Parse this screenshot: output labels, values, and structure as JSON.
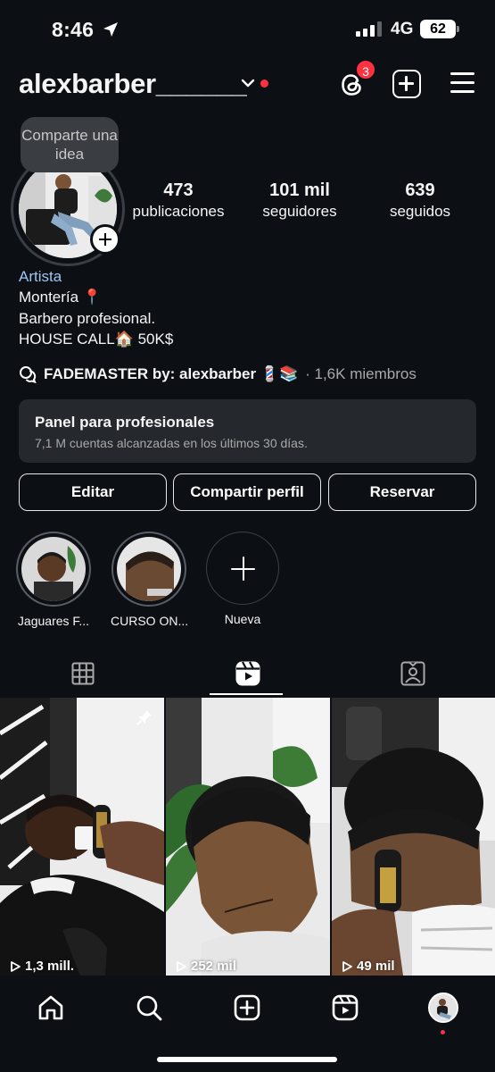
{
  "status_bar": {
    "time": "8:46",
    "network": "4G",
    "battery": "62"
  },
  "header": {
    "username": "alexbarber______",
    "threads_badge": "3"
  },
  "profile": {
    "tooltip": "Comparte una idea",
    "stats": [
      {
        "value": "473",
        "label": "publicaciones"
      },
      {
        "value": "101 mil",
        "label": "seguidores"
      },
      {
        "value": "639",
        "label": "seguidos"
      }
    ],
    "category": "Artista",
    "bio": [
      "Montería 📍",
      "Barbero profesional.",
      "HOUSE CALL🏠 50K$"
    ],
    "community": {
      "name": "FADEMASTER by: alexbarber 💈📚",
      "members": "· 1,6K miembros"
    }
  },
  "pro_panel": {
    "title": "Panel para profesionales",
    "subtitle": "7,1 M cuentas alcanzadas en los últimos 30 días."
  },
  "actions": {
    "edit": "Editar",
    "share": "Compartir perfil",
    "book": "Reservar"
  },
  "highlights": [
    {
      "label": "Jaguares F..."
    },
    {
      "label": "CURSO ON..."
    },
    {
      "label": "Nueva"
    }
  ],
  "tabs": {
    "active": "reels",
    "icons": [
      "grid-icon",
      "reels-icon",
      "tagged-icon"
    ]
  },
  "reels": [
    {
      "views": "1,3 mill.",
      "pinned": true
    },
    {
      "views": "252 mil",
      "pinned": false
    },
    {
      "views": "49 mil",
      "pinned": false
    }
  ],
  "bottom_nav": {
    "icons": [
      "home-icon",
      "search-icon",
      "create-icon",
      "reels-icon",
      "profile-avatar"
    ]
  },
  "colors": {
    "background": "#0c1014",
    "accent_red": "#ff3040",
    "category_blue": "#a0c4f2",
    "panel": "#25292e"
  }
}
